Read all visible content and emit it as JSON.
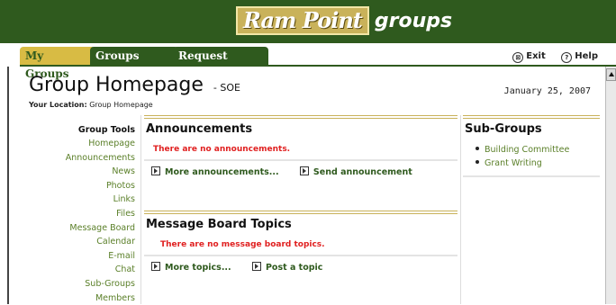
{
  "brand": {
    "logo_mark": "Ram Point",
    "logo_text": "groups"
  },
  "tabs": {
    "my_groups": "My Groups",
    "groups_index": "Groups Index",
    "request_group": "Request Group"
  },
  "top_links": {
    "exit": "Exit",
    "help": "Help",
    "exit_icon": "⊠",
    "help_icon": "?"
  },
  "page": {
    "title": "Group Homepage",
    "subtitle": "- SOE",
    "date": "January 25, 2007",
    "location_label": "Your Location:",
    "location_value": "Group Homepage"
  },
  "tools": {
    "heading": "Group Tools",
    "items": [
      "Homepage",
      "Announcements",
      "News",
      "Photos",
      "Links",
      "Files",
      "Message Board",
      "Calendar",
      "E-mail",
      "Chat",
      "Sub-Groups",
      "Members"
    ]
  },
  "announcements": {
    "title": "Announcements",
    "empty": "There are no announcements.",
    "more": "More announcements...",
    "send": "Send announcement"
  },
  "message_board": {
    "title": "Message Board Topics",
    "empty": "There are no message board topics.",
    "more": "More topics...",
    "post": "Post a topic"
  },
  "subgroups": {
    "title": "Sub-Groups",
    "items": [
      "Building Committee",
      "Grant Writing"
    ]
  },
  "colors": {
    "banner": "#2f5a1e",
    "tab_active": "#d8bb44",
    "link": "#5a7f28",
    "alert": "#e02020"
  }
}
